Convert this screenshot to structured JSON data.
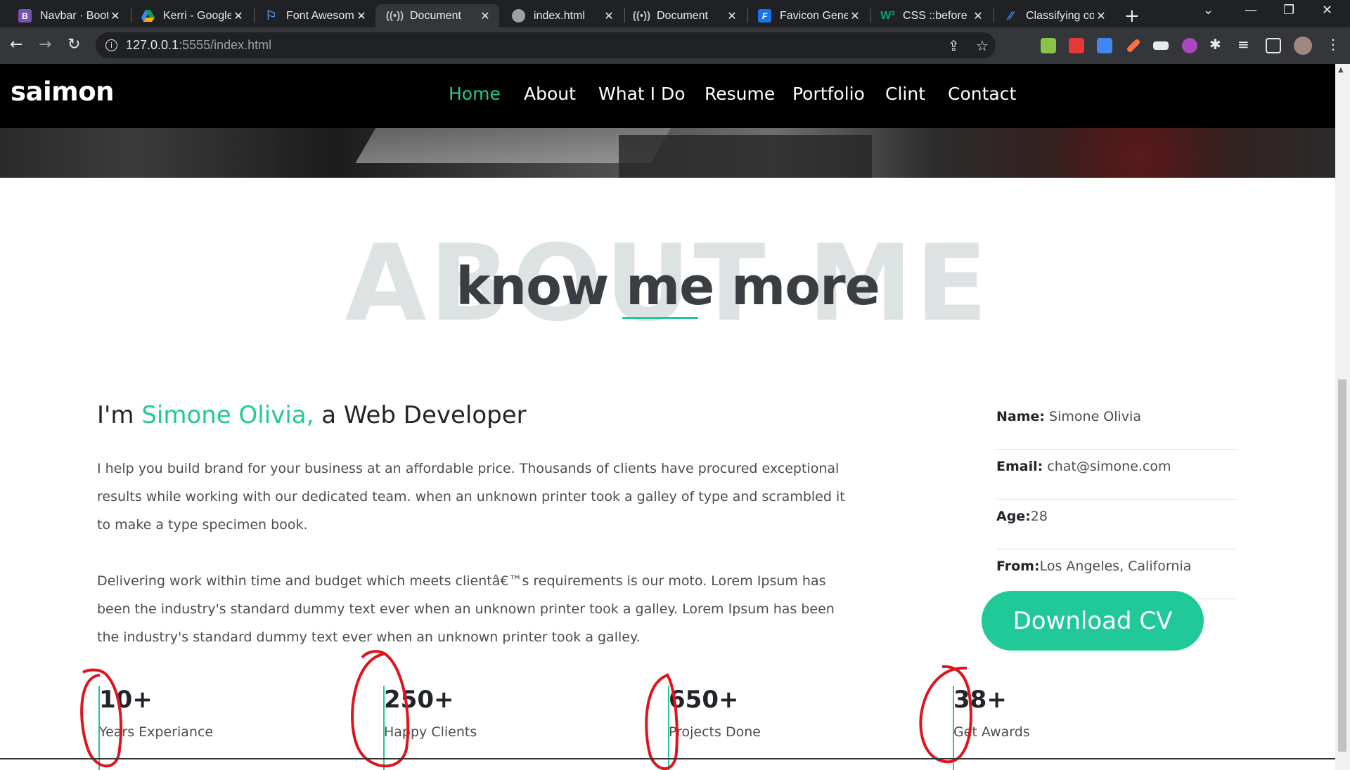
{
  "browser": {
    "tabs": [
      {
        "title": "Navbar · Bootstrap",
        "favicon": "bootstrap-icon",
        "color": "#7952b3",
        "active": false
      },
      {
        "title": "Kerri - Google Drive",
        "favicon": "google-drive-icon",
        "color": "#f4b400",
        "active": false
      },
      {
        "title": "Font Awesome",
        "favicon": "flag-icon",
        "color": "#538dd7",
        "active": false
      },
      {
        "title": "Document",
        "favicon": "live-server-icon",
        "color": "#9aa0a6",
        "active": true
      },
      {
        "title": "index.html",
        "favicon": "globe-icon",
        "color": "#9aa0a6",
        "active": false
      },
      {
        "title": "Document",
        "favicon": "live-server-icon",
        "color": "#9aa0a6",
        "active": false
      },
      {
        "title": "Favicon Generator",
        "favicon": "favicon-generator-icon",
        "color": "#1a73e8",
        "active": false
      },
      {
        "title": "CSS ::before Selector",
        "favicon": "w3schools-icon",
        "color": "#04aa6d",
        "active": false
      },
      {
        "title": "Classifying content",
        "favicon": "pen-icon",
        "color": "#4285f4",
        "active": false
      }
    ],
    "url_host": "127.0.0.1",
    "url_path": ":5555/index.html"
  },
  "site": {
    "brand": "saimon",
    "nav": [
      "Home",
      "About",
      "What I Do",
      "Resume",
      "Portfolio",
      "Clint",
      "Contact"
    ],
    "active_nav": "Home",
    "accent": "#20c997"
  },
  "about": {
    "bg_title": "ABOUT ME",
    "title": "know me more",
    "intro_prefix": "I'm ",
    "intro_name": "Simone Olivia,",
    "intro_suffix": " a Web Developer",
    "paragraph1": "I help you build brand for your business at an affordable price. Thousands of clients have procured exceptional results while working with our dedicated team. when an unknown printer took a galley of type and scrambled it to make a type specimen book.",
    "paragraph2": "Delivering work within time and budget which meets clientâ€™s requirements is our moto. Lorem Ipsum has been the industry's standard dummy text ever when an unknown printer took a galley. Lorem Ipsum has been the industry's standard dummy text ever when an unknown printer took a galley.",
    "info": [
      {
        "key": "Name:",
        "value": " Simone Olivia"
      },
      {
        "key": "Email:",
        "value": " chat@simone.com"
      },
      {
        "key": "Age:",
        "value": "28"
      },
      {
        "key": "From:",
        "value": "Los Angeles, California"
      }
    ],
    "cv_button": "Download CV",
    "stats": [
      {
        "number": "10+",
        "label": "Years Experiance"
      },
      {
        "number": "250+",
        "label": "Happy Clients"
      },
      {
        "number": "650+",
        "label": "Projects Done"
      },
      {
        "number": "38+",
        "label": "Get Awards"
      }
    ]
  },
  "annotation_color": "#e0141e"
}
